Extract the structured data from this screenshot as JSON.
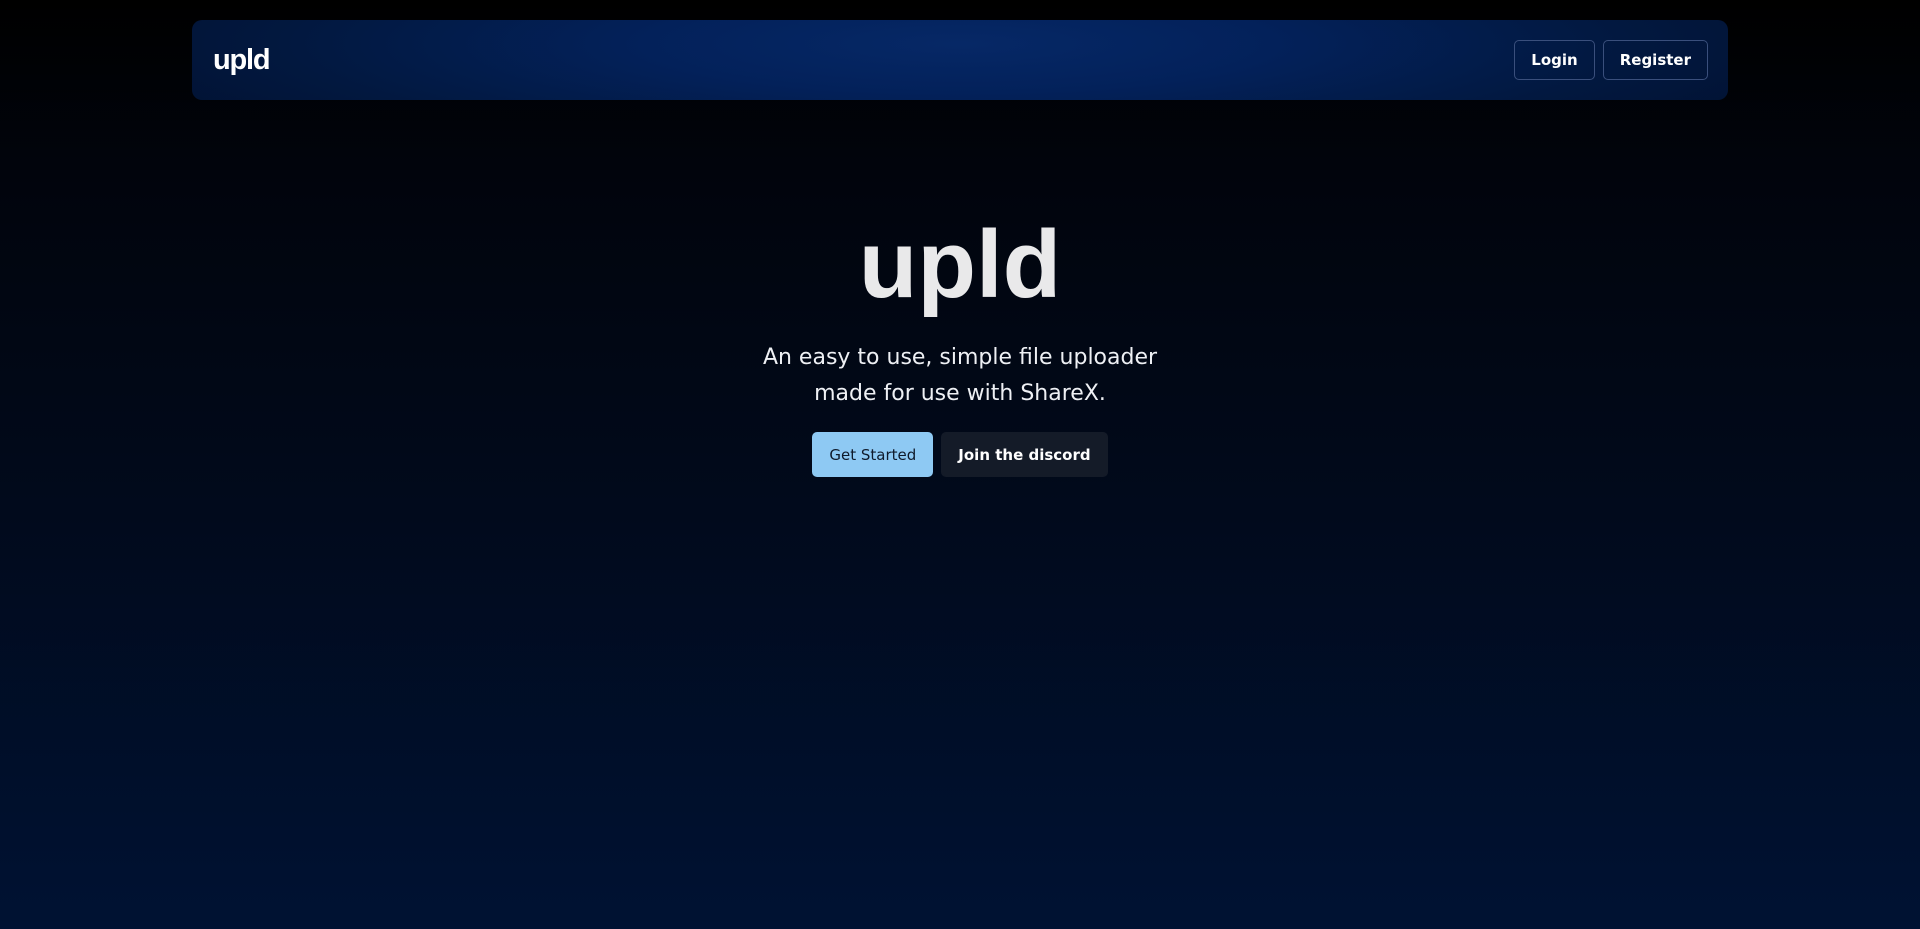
{
  "navbar": {
    "brand": "upld",
    "login_label": "Login",
    "register_label": "Register"
  },
  "hero": {
    "title": "upld",
    "subtitle": "An easy to use, simple file uploader made for use with ShareX.",
    "primary_label": "Get Started",
    "secondary_label": "Join the discord"
  },
  "colors": {
    "primary_button": "#8ec9f3",
    "secondary_button": "#141b28",
    "navbar": "#03215a"
  }
}
